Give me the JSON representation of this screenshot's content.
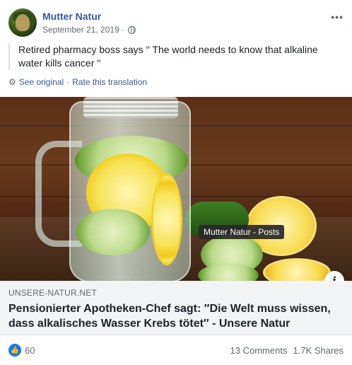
{
  "post": {
    "page_name": "Mutter Natur",
    "date": "September 21, 2019",
    "separator": "·",
    "text": "Retired pharmacy boss says ′′ The world needs to know that alkaline water kills cancer ′′",
    "icons": {
      "avatar": "page-avatar",
      "privacy": "globe-icon",
      "more": "more-options-icon",
      "settings": "gear-icon"
    }
  },
  "translation": {
    "see_original": "See original",
    "separator": "·",
    "rate": "Rate this translation"
  },
  "media": {
    "tooltip": "Mutter Natur - Posts",
    "info_glyph": "i"
  },
  "link_card": {
    "domain": "UNSERE-NATUR.NET",
    "title": "Pensionierter Apotheken-Chef sagt: ″Die Welt muss wissen, dass alkalisches Wasser Krebs tötet″ - Unsere Natur"
  },
  "footer": {
    "reaction_count": "60",
    "comments": "13 Comments",
    "shares": "1.7K Shares"
  },
  "colors": {
    "link_blue": "#385898",
    "like_blue": "#1877f2",
    "muted_gray": "#606770",
    "card_bg": "#f2f3f5"
  }
}
